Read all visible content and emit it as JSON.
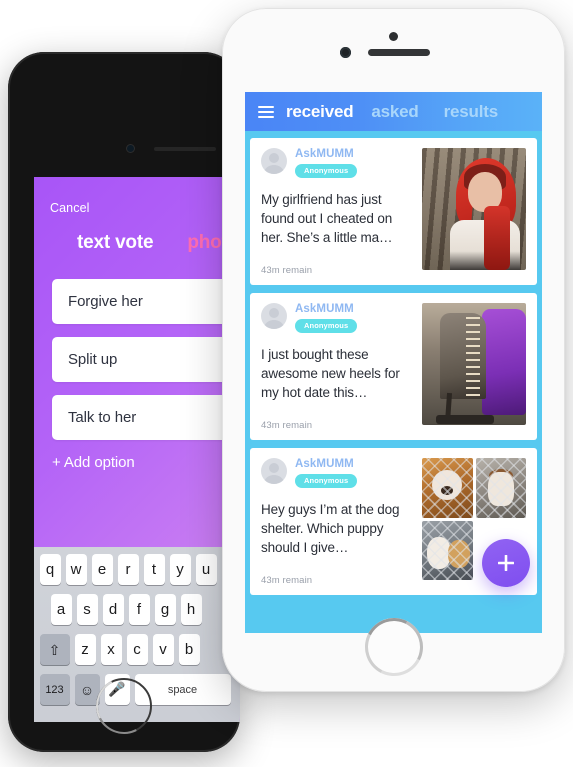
{
  "left_phone": {
    "compose": {
      "cancel_label": "Cancel",
      "tabs": [
        {
          "label": "text vote",
          "active": true
        },
        {
          "label": "photo",
          "active": false
        }
      ],
      "options": [
        {
          "value": "Forgive her"
        },
        {
          "value": "Split up"
        },
        {
          "value": "Talk to her"
        }
      ],
      "add_option_label": "+ Add option"
    },
    "keyboard": {
      "row1": [
        "q",
        "w",
        "e",
        "r",
        "t",
        "y",
        "u"
      ],
      "row2": [
        "a",
        "s",
        "d",
        "f",
        "g",
        "h"
      ],
      "row3_shift": "⇧",
      "row3": [
        "z",
        "x",
        "c",
        "v",
        "b"
      ],
      "row4": {
        "numbers_label": "123",
        "emoji_label": "☺",
        "mic_label": "🎤",
        "space_label": "space"
      }
    }
  },
  "right_phone": {
    "header": {
      "menu_icon": "hamburger-icon",
      "tabs": [
        {
          "label": "received",
          "active": true
        },
        {
          "label": "asked",
          "active": false
        },
        {
          "label": "results",
          "active": false
        }
      ]
    },
    "feed": {
      "cards": [
        {
          "username": "AskMUMM",
          "badge": "Anonymous",
          "question": "My girlfriend has just found out I cheated on her. She’s a little ma…",
          "remain": "43m remain",
          "media": "photo-forest-woman"
        },
        {
          "username": "AskMUMM",
          "badge": "Anonymous",
          "question": "I just bought these awesome new heels for my hot date this…",
          "remain": "43m remain",
          "media": "photo-heels"
        },
        {
          "username": "AskMUMM",
          "badge": "Anonymous",
          "question": "Hey guys I’m at the dog shelter. Which puppy should I give…",
          "remain": "43m remain",
          "media": "photo-grid-puppies"
        }
      ]
    },
    "fab": {
      "icon": "plus-icon",
      "color": "#7f4ef0"
    }
  },
  "colors": {
    "header_gradient_start": "#4a85f6",
    "header_gradient_end": "#5ab2f8",
    "feed_background": "#57c9f0",
    "badge": "#5fdfe8",
    "username": "#8fb8f2",
    "compose_purple": "#b464f7",
    "compose_pink": "#ff6db1",
    "fab_purple": "#7f4ef0"
  }
}
